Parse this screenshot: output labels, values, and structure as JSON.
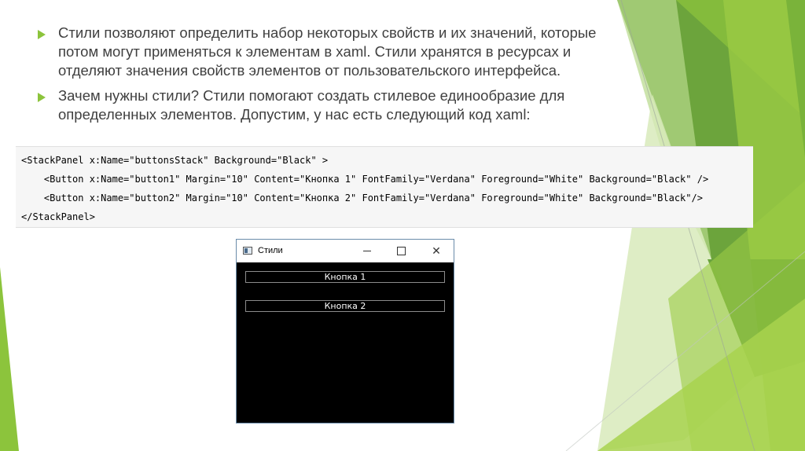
{
  "bullets": [
    "Стили позволяют определить набор некоторых свойств и их значений, которые потом могут применяться к элементам в xaml. Стили хранятся в ресурсах и отделяют значения свойств элементов от пользовательского интерфейса.",
    "Зачем нужны стили? Стили помогают создать стилевое единообразие для определенных элементов. Допустим, у нас есть следующий код xaml:"
  ],
  "code_lines": [
    "<StackPanel x:Name=\"buttonsStack\" Background=\"Black\" >",
    "    <Button x:Name=\"button1\" Margin=\"10\" Content=\"Кнопка 1\" FontFamily=\"Verdana\" Foreground=\"White\" Background=\"Black\" />",
    "    <Button x:Name=\"button2\" Margin=\"10\" Content=\"Кнопка 2\" FontFamily=\"Verdana\" Foreground=\"White\" Background=\"Black\"/>",
    "</StackPanel>"
  ],
  "window": {
    "title": "Стили",
    "close_glyph": "✕",
    "buttons": [
      "Кнопка 1",
      "Кнопка 2"
    ]
  },
  "colors": {
    "accent_green": "#8cc43c",
    "text_gray": "#404040"
  }
}
